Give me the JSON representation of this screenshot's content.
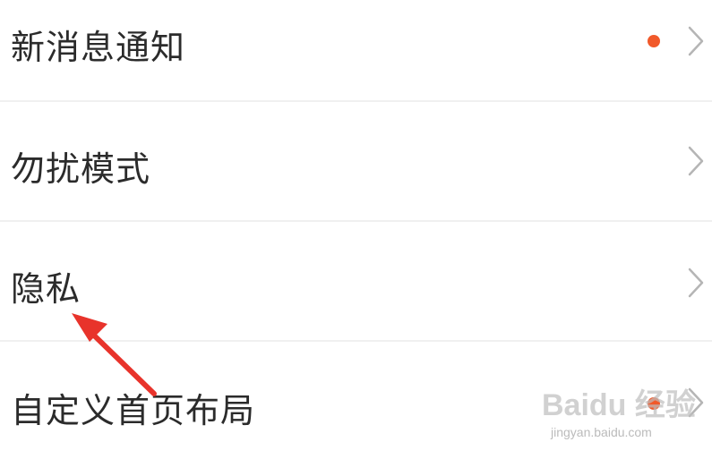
{
  "settings": {
    "items": [
      {
        "label": "新消息通知",
        "has_badge": true
      },
      {
        "label": "勿扰模式",
        "has_badge": false
      },
      {
        "label": "隐私",
        "has_badge": false
      },
      {
        "label": "自定义首页布局",
        "has_badge": true
      }
    ]
  },
  "annotation": {
    "arrow_target": "隐私",
    "arrow_color": "#e8332b"
  },
  "watermark": {
    "logo_text": "Baidu 经验",
    "url": "jingyan.baidu.com"
  },
  "colors": {
    "badge": "#f1592a",
    "chevron": "#b5b5b5",
    "text": "#2b2b2b",
    "divider": "#f0f0f0"
  }
}
